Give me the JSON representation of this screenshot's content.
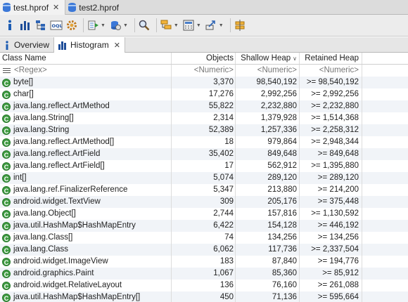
{
  "editor_tabs": [
    {
      "label": "test.hprof",
      "active": true,
      "close": "✕"
    },
    {
      "label": "test2.hprof",
      "active": false
    }
  ],
  "toolbar": {
    "icons": [
      "info-icon",
      "histogram-icon",
      "dominator-tree-icon",
      "oql-icon",
      "gear-icon",
      "run-query-icon",
      "heap-dump-icon",
      "search-icon",
      "group-by-icon",
      "calculator-icon",
      "export-icon",
      "pin-icon"
    ]
  },
  "view_tabs": [
    {
      "label": "Overview",
      "active": false
    },
    {
      "label": "Histogram",
      "active": true,
      "close": "✕"
    }
  ],
  "table": {
    "headers": {
      "class_name": "Class Name",
      "objects": "Objects",
      "shallow_heap": "Shallow Heap",
      "retained_heap": "Retained Heap"
    },
    "filter_row": {
      "class_name": "<Regex>",
      "objects": "<Numeric>",
      "shallow_heap": "<Numeric>",
      "retained_heap": "<Numeric>"
    },
    "rows": [
      {
        "name": "byte[]",
        "objects": "3,370",
        "shallow": "98,540,192",
        "retained": ">= 98,540,192"
      },
      {
        "name": "char[]",
        "objects": "17,276",
        "shallow": "2,992,256",
        "retained": ">= 2,992,256"
      },
      {
        "name": "java.lang.reflect.ArtMethod",
        "objects": "55,822",
        "shallow": "2,232,880",
        "retained": ">= 2,232,880"
      },
      {
        "name": "java.lang.String[]",
        "objects": "2,314",
        "shallow": "1,379,928",
        "retained": ">= 1,514,368"
      },
      {
        "name": "java.lang.String",
        "objects": "52,389",
        "shallow": "1,257,336",
        "retained": ">= 2,258,312"
      },
      {
        "name": "java.lang.reflect.ArtMethod[]",
        "objects": "18",
        "shallow": "979,864",
        "retained": ">= 2,948,344"
      },
      {
        "name": "java.lang.reflect.ArtField",
        "objects": "35,402",
        "shallow": "849,648",
        "retained": ">= 849,648"
      },
      {
        "name": "java.lang.reflect.ArtField[]",
        "objects": "17",
        "shallow": "562,912",
        "retained": ">= 1,395,880"
      },
      {
        "name": "int[]",
        "objects": "5,074",
        "shallow": "289,120",
        "retained": ">= 289,120"
      },
      {
        "name": "java.lang.ref.FinalizerReference",
        "objects": "5,347",
        "shallow": "213,880",
        "retained": ">= 214,200"
      },
      {
        "name": "android.widget.TextView",
        "objects": "309",
        "shallow": "205,176",
        "retained": ">= 375,448"
      },
      {
        "name": "java.lang.Object[]",
        "objects": "2,744",
        "shallow": "157,816",
        "retained": ">= 1,130,592"
      },
      {
        "name": "java.util.HashMap$HashMapEntry",
        "objects": "6,422",
        "shallow": "154,128",
        "retained": ">= 446,192"
      },
      {
        "name": "java.lang.Class[]",
        "objects": "74",
        "shallow": "134,256",
        "retained": ">= 134,256"
      },
      {
        "name": "java.lang.Class",
        "objects": "6,062",
        "shallow": "117,736",
        "retained": ">= 2,337,504"
      },
      {
        "name": "android.widget.ImageView",
        "objects": "183",
        "shallow": "87,840",
        "retained": ">= 194,776"
      },
      {
        "name": "android.graphics.Paint",
        "objects": "1,067",
        "shallow": "85,360",
        "retained": ">= 85,912"
      },
      {
        "name": "android.widget.RelativeLayout",
        "objects": "136",
        "shallow": "76,160",
        "retained": ">= 261,088"
      },
      {
        "name": "java.util.HashMap$HashMapEntry[]",
        "objects": "450",
        "shallow": "71,136",
        "retained": ">= 595,664"
      }
    ]
  },
  "colors": {
    "class_icon": "#3e9a41",
    "db_icon": "#3b78d8",
    "row_alt": "#f1f4f8"
  }
}
